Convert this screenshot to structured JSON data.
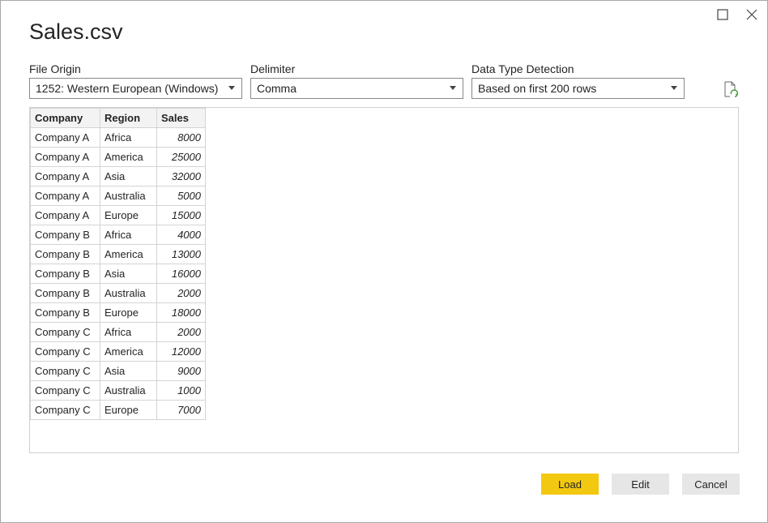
{
  "dialog": {
    "title": "Sales.csv"
  },
  "options": {
    "file_origin": {
      "label": "File Origin",
      "value": "1252: Western European (Windows)"
    },
    "delimiter": {
      "label": "Delimiter",
      "value": "Comma"
    },
    "type_detection": {
      "label": "Data Type Detection",
      "value": "Based on first 200 rows"
    }
  },
  "table": {
    "headers": [
      "Company",
      "Region",
      "Sales"
    ],
    "rows": [
      [
        "Company A",
        "Africa",
        "8000"
      ],
      [
        "Company A",
        "America",
        "25000"
      ],
      [
        "Company A",
        "Asia",
        "32000"
      ],
      [
        "Company A",
        "Australia",
        "5000"
      ],
      [
        "Company A",
        "Europe",
        "15000"
      ],
      [
        "Company B",
        "Africa",
        "4000"
      ],
      [
        "Company B",
        "America",
        "13000"
      ],
      [
        "Company B",
        "Asia",
        "16000"
      ],
      [
        "Company B",
        "Australia",
        "2000"
      ],
      [
        "Company B",
        "Europe",
        "18000"
      ],
      [
        "Company C",
        "Africa",
        "2000"
      ],
      [
        "Company C",
        "America",
        "12000"
      ],
      [
        "Company C",
        "Asia",
        "9000"
      ],
      [
        "Company C",
        "Australia",
        "1000"
      ],
      [
        "Company C",
        "Europe",
        "7000"
      ]
    ]
  },
  "buttons": {
    "load": "Load",
    "edit": "Edit",
    "cancel": "Cancel"
  },
  "colors": {
    "primary_button": "#f2c811",
    "secondary_button": "#e6e6e6",
    "refresh_icon": "#4a9a3f"
  },
  "icons": {
    "maximize": "maximize-icon",
    "close": "close-icon",
    "refresh": "refresh-icon",
    "dropdown": "chevron-down-icon"
  }
}
